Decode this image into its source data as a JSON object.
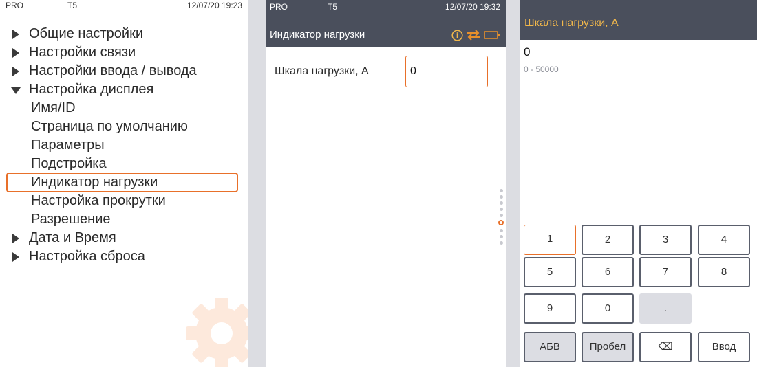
{
  "settings_panel": {
    "status": {
      "mode": "PRO",
      "model": "T5",
      "datetime": "12/07/20 19:23"
    },
    "menu": [
      {
        "label": "Общие настройки",
        "type": "top",
        "expanded": false
      },
      {
        "label": "Настройки связи",
        "type": "top",
        "expanded": false
      },
      {
        "label": "Настройки ввода / вывода",
        "type": "top",
        "expanded": false
      },
      {
        "label": "Настройка дисплея",
        "type": "top",
        "expanded": true
      },
      {
        "label": "Имя/ID",
        "type": "sub"
      },
      {
        "label": "Страница по умолчанию",
        "type": "sub"
      },
      {
        "label": "Параметры",
        "type": "sub"
      },
      {
        "label": "Подстройка",
        "type": "sub"
      },
      {
        "label": "Индикатор нагрузки",
        "type": "sub",
        "selected": true
      },
      {
        "label": "Настройка прокрутки",
        "type": "sub"
      },
      {
        "label": "Разрешение",
        "type": "sub"
      },
      {
        "label": "Дата и Время",
        "type": "top",
        "expanded": false
      },
      {
        "label": "Настройка сброса",
        "type": "top",
        "expanded": false
      }
    ]
  },
  "load_indicator_panel": {
    "status": {
      "mode": "PRO",
      "model": "T5",
      "datetime": "12/07/20 19:32"
    },
    "title": "Индикатор нагрузки",
    "icons": [
      "info-icon",
      "swap-arrows-icon",
      "battery-icon"
    ],
    "field": {
      "label": "Шкала нагрузки, А",
      "value": "0"
    }
  },
  "keypad_panel": {
    "title": "Шкала нагрузки, А",
    "value": "0",
    "range": "0 - 50000",
    "keys": [
      "1",
      "2",
      "3",
      "4",
      "5",
      "6",
      "7",
      "8",
      "9",
      "0",
      "."
    ],
    "actions": {
      "abc": "АБВ",
      "space": "Пробел",
      "backspace": "⌫",
      "enter": "Ввод"
    }
  },
  "colors": {
    "accent": "#e8702a",
    "header_bg": "#4a4f5c",
    "title_yellow": "#f2b84b"
  }
}
